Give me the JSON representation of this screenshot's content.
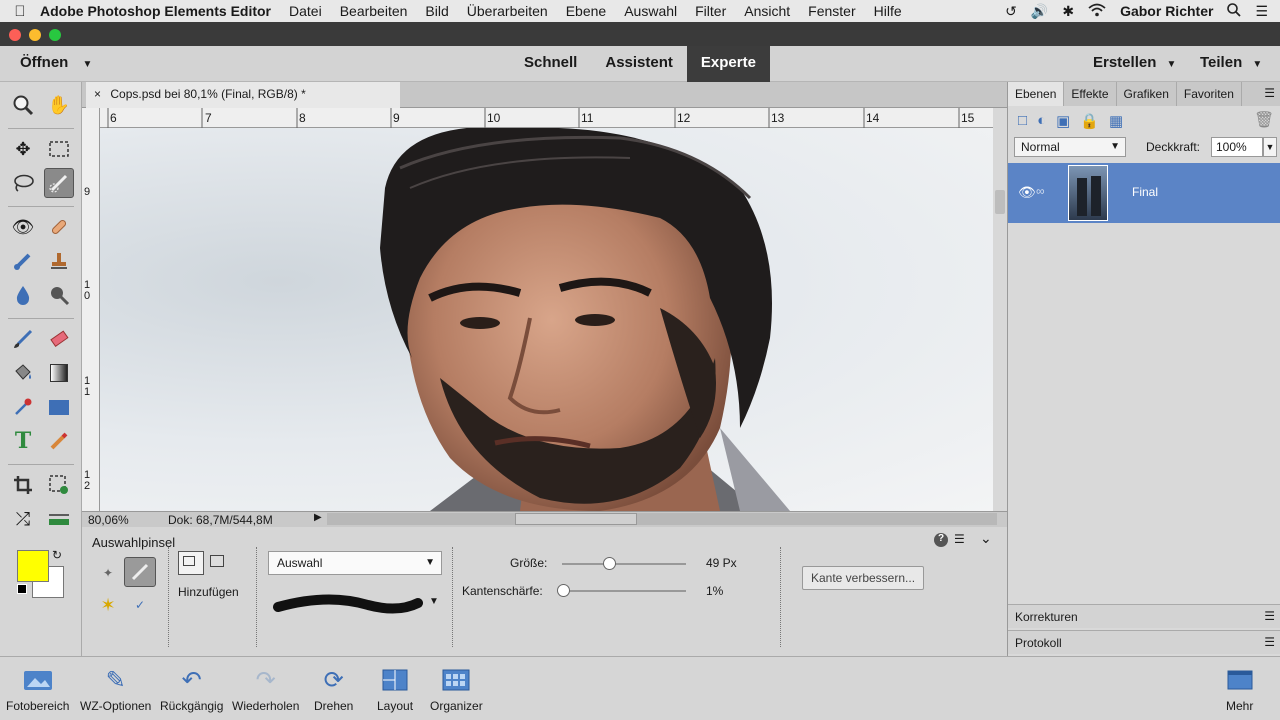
{
  "menubar": {
    "app_name": "Adobe Photoshop Elements Editor",
    "items": [
      "Datei",
      "Bearbeiten",
      "Bild",
      "Überarbeiten",
      "Ebene",
      "Auswahl",
      "Filter",
      "Ansicht",
      "Fenster",
      "Hilfe"
    ],
    "user": "Gabor Richter"
  },
  "topbar": {
    "open_label": "Öffnen",
    "modes": [
      "Schnell",
      "Assistent",
      "Experte"
    ],
    "active_mode": "Experte",
    "create_label": "Erstellen",
    "share_label": "Teilen"
  },
  "document": {
    "tab_title": "Cops.psd bei 80,1% (Final, RGB/8) *",
    "close_glyph": "×",
    "ruler_h": [
      "6",
      "7",
      "8",
      "9",
      "10",
      "11",
      "12",
      "13",
      "14",
      "15"
    ],
    "ruler_v": [
      "9",
      "1\n0",
      "1\n1",
      "1\n2"
    ],
    "zoom": "80,06%",
    "doc_size": "Dok: 68,7M/544,8M"
  },
  "options": {
    "tool_title": "Auswahlpinsel",
    "mode_label": "Hinzufügen",
    "mode_dropdown": "Auswahl",
    "size_label": "Größe:",
    "size_value": "49 Px",
    "size_fraction": 0.38,
    "feather_label": "Kantenschärfe:",
    "feather_value": "1%",
    "feather_fraction": 0.01,
    "refine_button": "Kante verbessern..."
  },
  "layers_panel": {
    "tabs": [
      "Ebenen",
      "Effekte",
      "Grafiken",
      "Favoriten"
    ],
    "active_tab": "Ebenen",
    "blend_mode": "Normal",
    "opacity_label": "Deckkraft:",
    "opacity_value": "100%",
    "layer_name": "Final",
    "corrections_label": "Korrekturen",
    "history_label": "Protokoll"
  },
  "taskbar": {
    "items": [
      {
        "label": "Fotobereich",
        "icon": "photo-bin-icon"
      },
      {
        "label": "WZ-Optionen",
        "icon": "tool-options-icon"
      },
      {
        "label": "Rückgängig",
        "icon": "undo-icon"
      },
      {
        "label": "Wiederholen",
        "icon": "redo-icon"
      },
      {
        "label": "Drehen",
        "icon": "rotate-icon"
      },
      {
        "label": "Layout",
        "icon": "layout-icon"
      },
      {
        "label": "Organizer",
        "icon": "organizer-icon"
      }
    ],
    "more_label": "Mehr"
  },
  "colors": {
    "foreground": "#ffff00",
    "background": "#ffffff",
    "selection_blue": "#5b84c6"
  }
}
